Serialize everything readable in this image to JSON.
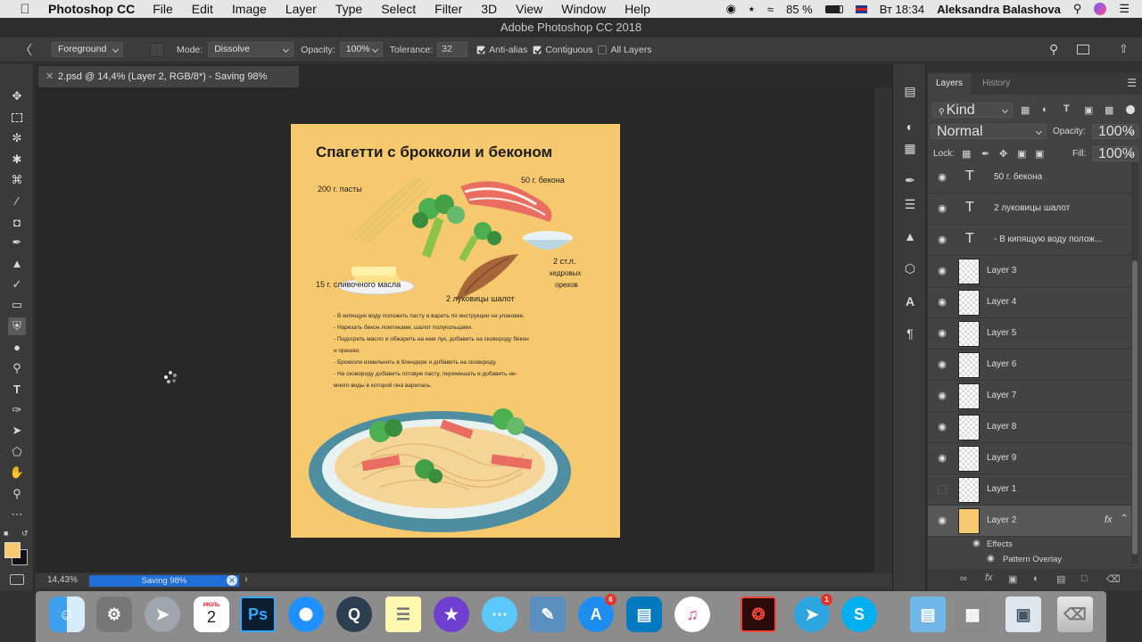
{
  "menubar": {
    "app_name": "Photoshop CC",
    "items": [
      "File",
      "Edit",
      "Image",
      "Layer",
      "Type",
      "Select",
      "Filter",
      "3D",
      "View",
      "Window",
      "Help"
    ],
    "battery": "85 %",
    "clock": "Вт 18:34",
    "user": "Aleksandra Balashova"
  },
  "titlebar": {
    "title": "Adobe Photoshop CC 2018"
  },
  "options": {
    "fill_source": "Foreground",
    "mode_label": "Mode:",
    "mode_value": "Dissolve",
    "opacity_label": "Opacity:",
    "opacity_value": "100%",
    "tolerance_label": "Tolerance:",
    "tolerance_value": "32",
    "antialias_label": "Anti-alias",
    "contiguous_label": "Contiguous",
    "all_layers_label": "All Layers"
  },
  "document": {
    "tab_title": "2.psd @ 14,4% (Layer 2, RGB/8*) - Saving 98%"
  },
  "artwork": {
    "title": "Спагетти с брокколи и беконом",
    "labels": {
      "pasta": "200 г. пасты",
      "bacon": "50 г. бекона",
      "butter": "15 г. сливочного масла",
      "shallot": "2 луковицы шалот",
      "nuts_1": "2 ст.л.",
      "nuts_2": "кедровых",
      "nuts_3": "орехов"
    },
    "steps": [
      "-  В кипящую воду положить пасту и варить по инструкции на упаковке.",
      "-  Нарезать бекон ломтиками, шалот полукольцами.",
      "-  Подогреть масло и обжарить на нем лук, добавить на сковороду бекон",
      "и орешки.",
      "-  Брокколи измельчить в блендере и добавить на сковороду.",
      "-  На сковороду добавить готовую пасту, перемешать и добавить не-",
      "много воды в которой она варилась."
    ]
  },
  "status": {
    "zoom": "14,43%",
    "progress_text": "Saving 98%",
    "progress": 0.98
  },
  "panel": {
    "tab_layers": "Layers",
    "tab_history": "History",
    "filter_kind": "Kind",
    "blend_mode": "Normal",
    "opacity_label": "Opacity:",
    "opacity_value": "100%",
    "lock_label": "Lock:",
    "fill_label": "Fill:",
    "fill_value": "100%",
    "layers": [
      {
        "name": "50 г. бекона",
        "kind": "text",
        "visible": true
      },
      {
        "name": "2 луковицы шалот",
        "kind": "text",
        "visible": true
      },
      {
        "name": "-  В кипящую воду полож...",
        "kind": "text",
        "visible": true
      },
      {
        "name": "Layer 3",
        "kind": "pixel",
        "visible": true
      },
      {
        "name": "Layer 4",
        "kind": "pixel",
        "visible": true
      },
      {
        "name": "Layer 5",
        "kind": "pixel",
        "visible": true
      },
      {
        "name": "Layer 6",
        "kind": "pixel",
        "visible": true
      },
      {
        "name": "Layer 7",
        "kind": "pixel",
        "visible": true
      },
      {
        "name": "Layer 8",
        "kind": "pixel",
        "visible": true
      },
      {
        "name": "Layer 9",
        "kind": "pixel",
        "visible": true
      },
      {
        "name": "Layer 1",
        "kind": "pixel",
        "visible": false
      },
      {
        "name": "Layer 2",
        "kind": "pixel",
        "visible": true,
        "selected": true
      }
    ],
    "fx_label": "fx",
    "effects_label": "Effects",
    "effect_item": "Pattern Overlay"
  },
  "dock": {
    "calendar_month": "ИЮЛЬ",
    "calendar_day": "2",
    "ps_label": "Ps",
    "app_store_badge": "6",
    "telegram_badge": "1"
  },
  "colors": {
    "foreground_swatch": "#f6c96f",
    "accent_progress": "#1f6fd6",
    "artboard_bg": "#f6c96f"
  }
}
